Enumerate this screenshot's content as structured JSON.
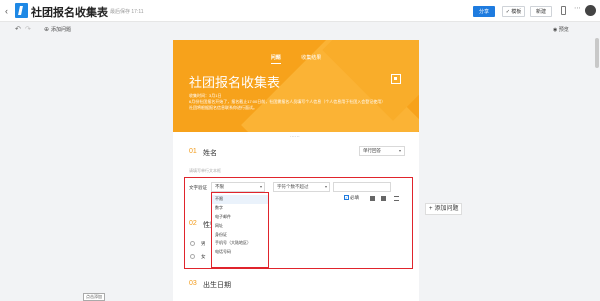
{
  "header": {
    "back_icon": "left-chevron-icon",
    "title": "社团报名收集表",
    "saved_status": "最后保存 17:11",
    "share_label": "分享",
    "template_label": "✓ 模板",
    "new_label": "新建"
  },
  "toolbar": {
    "add_question_label": "添加问题",
    "preview_label": "预览"
  },
  "form": {
    "tabs": [
      "问题",
      "收集结果"
    ],
    "title": "社团报名收集表",
    "desc_lines": [
      "收集时间：3月1日",
      "6月份社团报名开始了，报名截止17:00日前，社团需报名人员填写个人信息（个人信息用于社团入会登记使用）",
      "社团将根据报名信息联系你进行面试。"
    ],
    "q1": {
      "num": "01",
      "title": "姓名",
      "type": "单行回答",
      "hint": "请填写单行文本框",
      "validation_label": "文字验证",
      "validation_value": "不限",
      "length_value": "字符个数不超过",
      "required_label": "必填"
    },
    "dropdown_options": [
      "不限",
      "数字",
      "电子邮件",
      "网址",
      "身份证",
      "手机号（大陆地区）",
      "电话号码"
    ],
    "q2": {
      "num": "02",
      "title": "性别",
      "options": [
        "男",
        "女"
      ]
    },
    "q3": {
      "num": "03",
      "title": "出生日期"
    },
    "side_add_label": "添加问题",
    "tooltip": "点击添加"
  }
}
